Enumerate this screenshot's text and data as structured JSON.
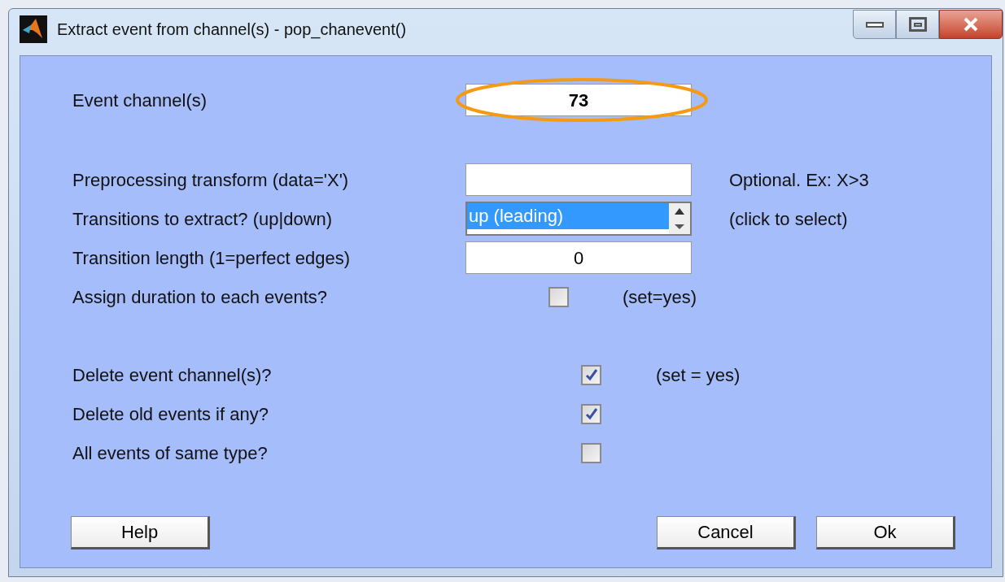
{
  "window": {
    "title": "Extract event from channel(s) - pop_chanevent()"
  },
  "groups": [
    [
      {
        "kind": "text",
        "label": "Event channel(s)",
        "value": "73",
        "bold": true,
        "highlighted": true
      }
    ],
    [
      {
        "kind": "text",
        "label": "Preprocessing transform (data='X')",
        "hint": "Optional. Ex: X>3"
      },
      {
        "kind": "listbox",
        "label": "Transitions to extract? (up|down)",
        "value": "up (leading)",
        "hint": "(click to select)"
      },
      {
        "kind": "text",
        "label": "Transition length (1=perfect edges)",
        "value": "0"
      },
      {
        "kind": "checkbox",
        "label": "Assign duration to each events?",
        "checked": false,
        "hint": "(set=yes)"
      }
    ],
    [
      {
        "kind": "checkbox",
        "label": "Delete event channel(s)?",
        "checked": true,
        "hint": "(set = yes)"
      },
      {
        "kind": "checkbox",
        "label": "Delete old events if any?",
        "checked": true
      },
      {
        "kind": "checkbox",
        "label": "All events of same type?",
        "checked": false
      }
    ]
  ],
  "buttons": [
    {
      "label": "Help"
    },
    {
      "label": "Cancel"
    },
    {
      "label": "Ok"
    }
  ]
}
